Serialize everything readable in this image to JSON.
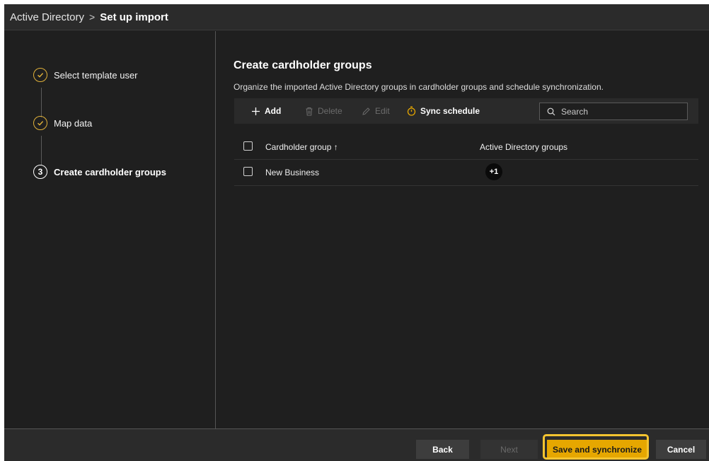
{
  "header": {
    "root": "Active Directory",
    "separator": ">",
    "current": "Set up import"
  },
  "steps": [
    {
      "label": "Select template user",
      "state": "done",
      "icon": "check-icon"
    },
    {
      "label": "Map data",
      "state": "done",
      "icon": "check-icon"
    },
    {
      "label": "Create cardholder groups",
      "state": "active",
      "number": "3"
    }
  ],
  "main": {
    "title": "Create cardholder groups",
    "description": "Organize the imported Active Directory groups in cardholder groups and schedule synchronization."
  },
  "toolbar": {
    "add_label": "Add",
    "delete_label": "Delete",
    "edit_label": "Edit",
    "sync_label": "Sync schedule",
    "search_placeholder": "Search"
  },
  "table": {
    "columns": [
      "Cardholder group ↑",
      "Active Directory groups"
    ],
    "rows": [
      {
        "name": "New Business",
        "ad_groups_badge": "+1"
      }
    ]
  },
  "footer": {
    "back_label": "Back",
    "next_label": "Next",
    "save_label": "Save and synchronize",
    "cancel_label": "Cancel"
  },
  "colors": {
    "accent": "#e6a700",
    "background": "#1f1f1f",
    "panel": "#2b2b2b"
  }
}
